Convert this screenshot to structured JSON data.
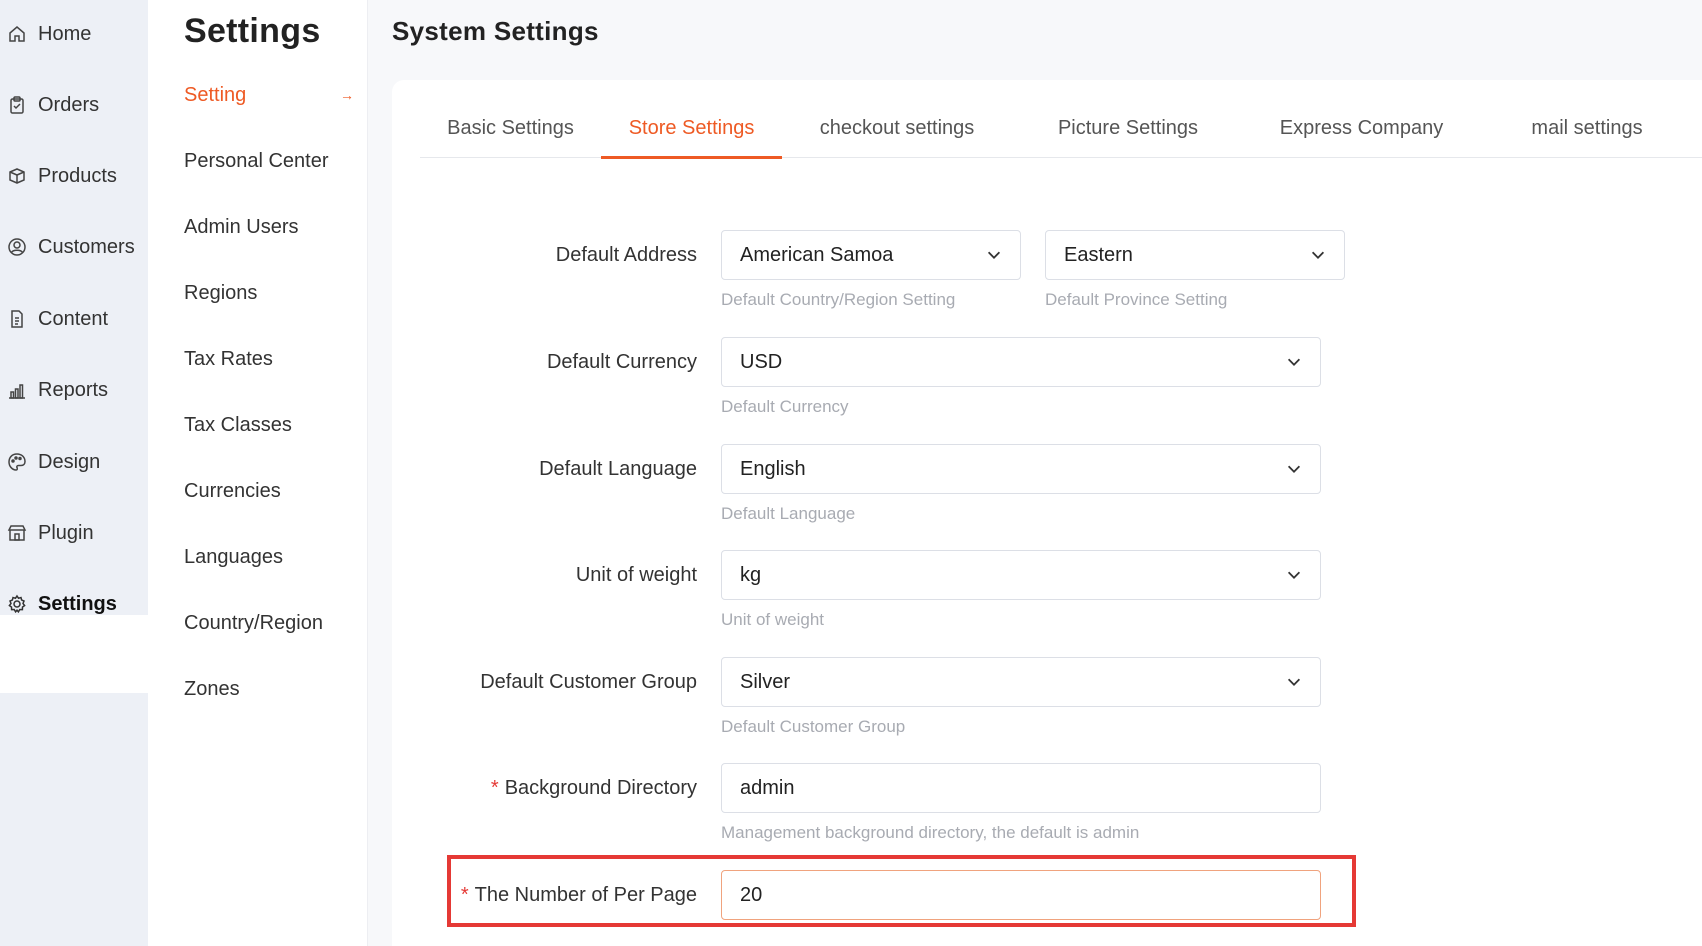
{
  "left_nav": {
    "items": [
      {
        "label": "Home",
        "icon": "home-icon"
      },
      {
        "label": "Orders",
        "icon": "clipboard-icon"
      },
      {
        "label": "Products",
        "icon": "box-icon"
      },
      {
        "label": "Customers",
        "icon": "user-circle-icon"
      },
      {
        "label": "Content",
        "icon": "document-icon"
      },
      {
        "label": "Reports",
        "icon": "bar-chart-icon"
      },
      {
        "label": "Design",
        "icon": "palette-icon"
      },
      {
        "label": "Plugin",
        "icon": "store-icon"
      },
      {
        "label": "Settings",
        "icon": "gear-icon",
        "active": true
      }
    ]
  },
  "sub_nav": {
    "title": "Settings",
    "items": [
      {
        "label": "Setting",
        "active": true
      },
      {
        "label": "Personal Center"
      },
      {
        "label": "Admin Users"
      },
      {
        "label": "Regions"
      },
      {
        "label": "Tax Rates"
      },
      {
        "label": "Tax Classes"
      },
      {
        "label": "Currencies"
      },
      {
        "label": "Languages"
      },
      {
        "label": "Country/Region"
      },
      {
        "label": "Zones"
      }
    ],
    "active_arrow": "→"
  },
  "main": {
    "title": "System Settings",
    "tabs": [
      {
        "label": "Basic Settings"
      },
      {
        "label": "Store Settings",
        "active": true
      },
      {
        "label": "checkout settings"
      },
      {
        "label": "Picture Settings"
      },
      {
        "label": "Express Company"
      },
      {
        "label": "mail settings"
      }
    ]
  },
  "form": {
    "default_address": {
      "label": "Default Address",
      "country_value": "American Samoa",
      "country_hint": "Default Country/Region Setting",
      "province_value": "Eastern",
      "province_hint": "Default Province Setting"
    },
    "default_currency": {
      "label": "Default Currency",
      "value": "USD",
      "hint": "Default Currency"
    },
    "default_language": {
      "label": "Default Language",
      "value": "English",
      "hint": "Default Language"
    },
    "unit_of_weight": {
      "label": "Unit of weight",
      "value": "kg",
      "hint": "Unit of weight"
    },
    "default_customer_group": {
      "label": "Default Customer Group",
      "value": "Silver",
      "hint": "Default Customer Group"
    },
    "background_directory": {
      "label": "Background Directory",
      "required_mark": "*",
      "value": "admin",
      "hint": "Management background directory, the default is admin"
    },
    "per_page": {
      "label": "The Number of Per Page",
      "required_mark": "*",
      "value": "20"
    }
  },
  "colors": {
    "accent": "#ee5a24",
    "highlight": "#e53935",
    "nav_bg": "#edf0f6",
    "hint": "#a8abb2"
  }
}
